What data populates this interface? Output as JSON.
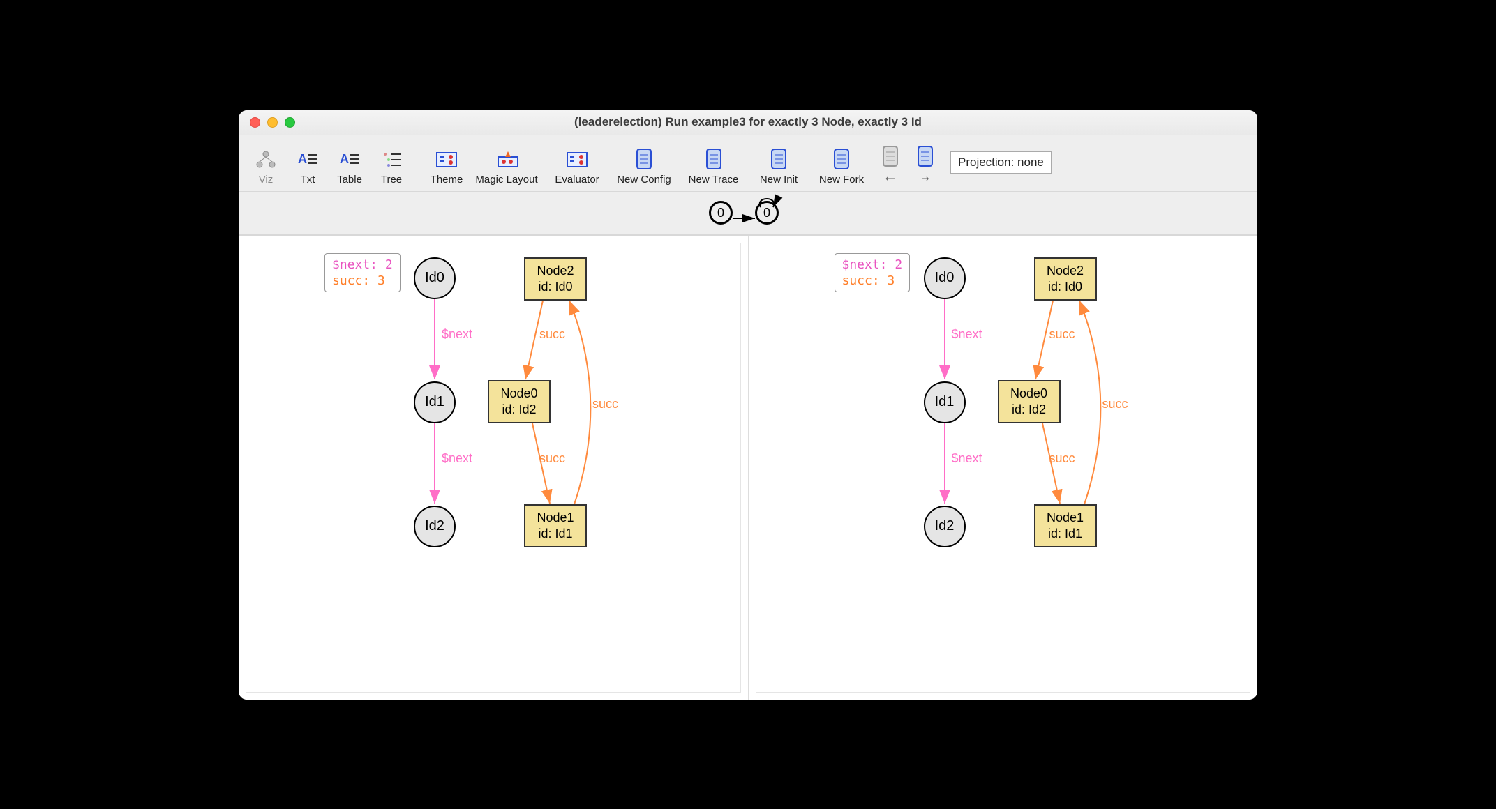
{
  "window": {
    "title": "(leaderelection) Run example3 for exactly 3 Node, exactly 3 Id"
  },
  "toolbar": {
    "viz": "Viz",
    "txt": "Txt",
    "table": "Table",
    "tree": "Tree",
    "theme": "Theme",
    "magic": "Magic Layout",
    "evaluator": "Evaluator",
    "newconfig": "New Config",
    "newtrace": "New Trace",
    "newinit": "New Init",
    "newfork": "New Fork",
    "prev": "⟵",
    "next": "→",
    "projection": "Projection: none"
  },
  "state": {
    "s0": "0",
    "s1": "0"
  },
  "legend": {
    "next": "$next: 2",
    "succ": "succ: 3"
  },
  "ids": {
    "id0": "Id0",
    "id1": "Id1",
    "id2": "Id2"
  },
  "nodes": {
    "n2a": "Node2",
    "n2b": "id: Id0",
    "n0a": "Node0",
    "n0b": "id: Id2",
    "n1a": "Node1",
    "n1b": "id: Id1"
  },
  "edge": {
    "next": "$next",
    "succ": "succ"
  }
}
